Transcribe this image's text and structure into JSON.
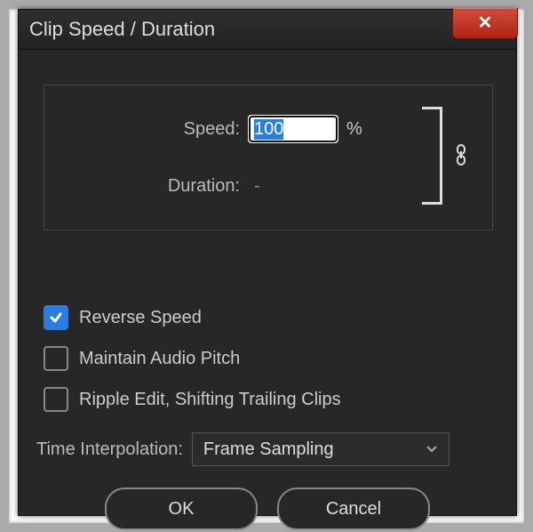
{
  "window": {
    "title": "Clip Speed / Duration"
  },
  "panel": {
    "speed_label": "Speed:",
    "speed_value": "100",
    "speed_unit": "%",
    "duration_label": "Duration:",
    "duration_value": "-"
  },
  "checkboxes": {
    "reverse": {
      "label": "Reverse Speed",
      "checked": true
    },
    "pitch": {
      "label": "Maintain Audio Pitch",
      "checked": false
    },
    "ripple": {
      "label": "Ripple Edit, Shifting Trailing Clips",
      "checked": false
    }
  },
  "interp": {
    "label": "Time Interpolation:",
    "value": "Frame Sampling"
  },
  "buttons": {
    "ok": "OK",
    "cancel": "Cancel"
  }
}
